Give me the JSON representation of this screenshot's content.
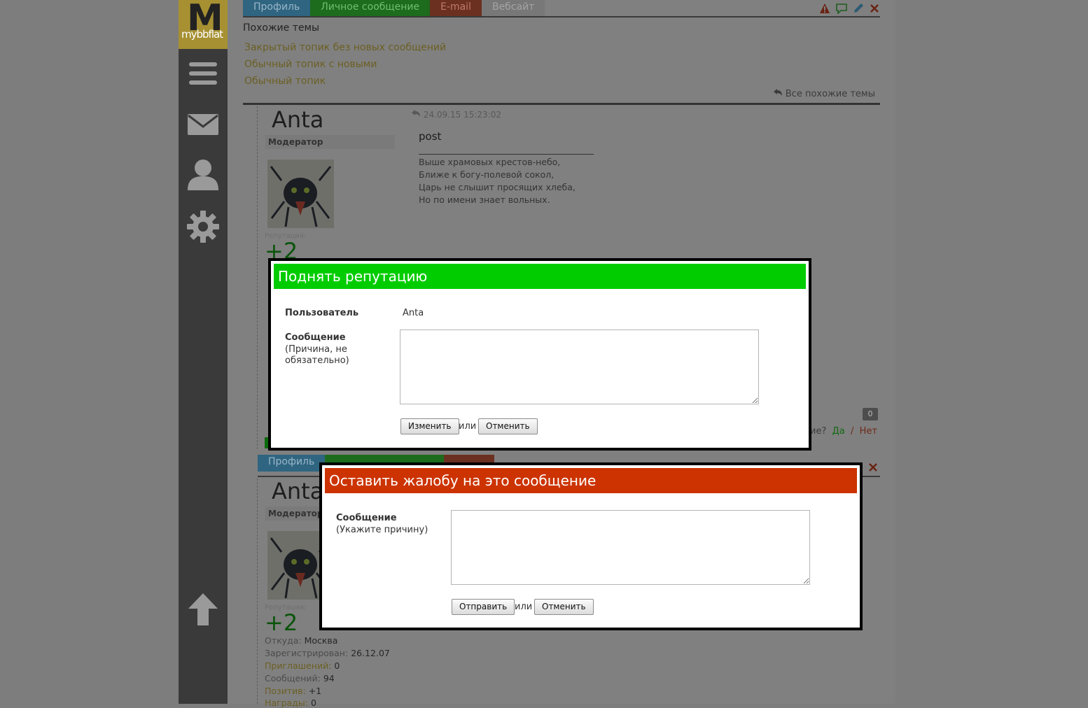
{
  "sidebar": {
    "logo_letter": "M",
    "logo_text": "mybbflat",
    "icons": [
      "menu-icon",
      "mail-icon",
      "user-icon",
      "gear-icon",
      "arrow-up-icon"
    ]
  },
  "post_tabs": {
    "profile": "Профиль",
    "pm": "Личное сообщение",
    "email": "E-mail",
    "website": "Вебсайт"
  },
  "second_post_tabs": {
    "profile": "Профиль"
  },
  "similar_topics": {
    "title": "Похожие темы",
    "links": [
      "Закрытый топик без новых сообщений",
      "Обычный топик с новыми",
      "Обычный топик"
    ],
    "all_link": "Все похожие темы"
  },
  "post1": {
    "author": "Anta",
    "role": "Модератор",
    "rep_label": "Репутация:",
    "rep_value": "+2",
    "date": "24.09.15 15:23:02",
    "title": "post",
    "poem": [
      "Выше храмовых крестов-небо,",
      "Ближе к богу-полевой сокол,",
      "Царь не слышит просящих хлеба,",
      "Но по имени знает вольных."
    ],
    "count": "0",
    "helpful_question": "ие?",
    "helpful_yes": "Да",
    "helpful_sep": "/",
    "helpful_no": "Нет"
  },
  "post2": {
    "author": "Anta",
    "role": "Модератор",
    "rep_label": "Репутация:",
    "rep_value": "+2",
    "info": [
      {
        "k": "Откуда:",
        "v": "Москва"
      },
      {
        "k": "Зарегистрирован:",
        "v": "26.12.07"
      },
      {
        "k": "Приглашений:",
        "v": "0"
      },
      {
        "k": "Сообщений:",
        "v": "94"
      },
      {
        "k": "Позитив:",
        "v": "+1"
      },
      {
        "k": "Награды:",
        "v": "0"
      }
    ]
  },
  "rep_modal": {
    "title": "Поднять репутацию",
    "user_label": "Пользователь",
    "user_value": "Anta",
    "message_label": "Сообщение",
    "message_hint_1": "(Причина, не",
    "message_hint_2": "обязательно)",
    "message_value": "",
    "submit": "Изменить",
    "or": "или",
    "cancel": "Отменить",
    "color": "#00cc00"
  },
  "report_modal": {
    "title": "Оставить жалобу на это сообщение",
    "message_label": "Сообщение",
    "message_hint": "(Укажите причину)",
    "message_value": "",
    "submit": "Отправить",
    "or": "или",
    "cancel": "Отменить",
    "color": "#cc3300"
  }
}
